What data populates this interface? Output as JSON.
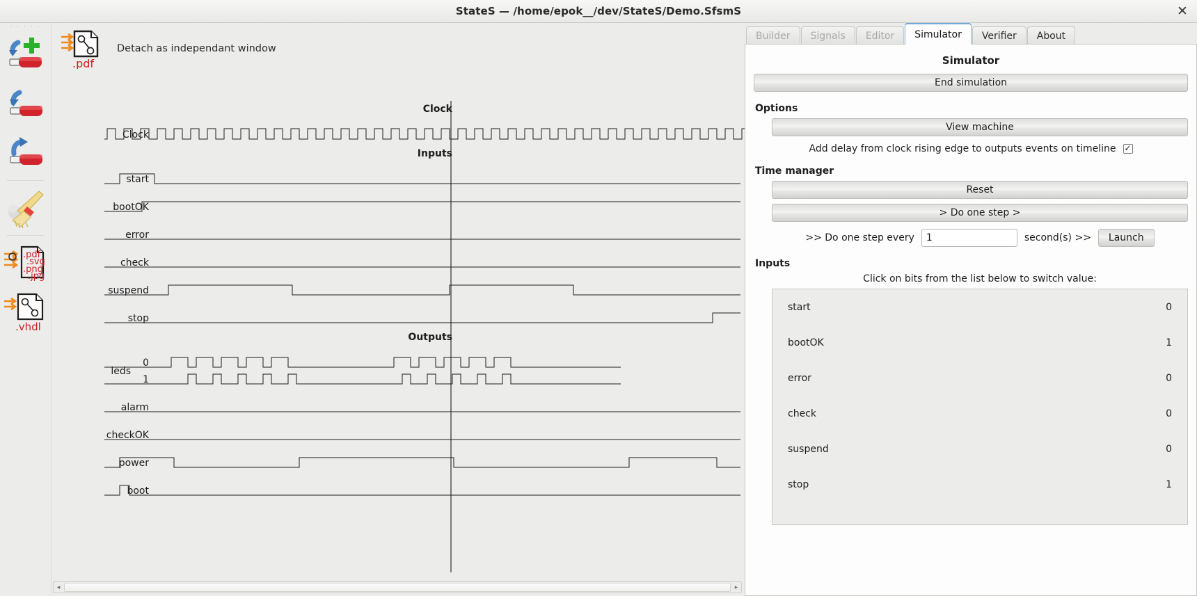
{
  "window": {
    "title": "StateS — /home/epok__/dev/StateS/Demo.SfsmS",
    "close_label": "✕"
  },
  "rail": {
    "handle": "· · · · ·",
    "items": [
      {
        "name": "save-as-new-icon",
        "tooltip": "Save as new"
      },
      {
        "name": "save-icon",
        "tooltip": "Save"
      },
      {
        "name": "load-icon",
        "tooltip": "Load"
      },
      {
        "name": "clear-icon",
        "tooltip": "Clear"
      },
      {
        "name": "export-image-icon",
        "labels": [
          ".pdf",
          ".svg",
          ".png",
          ".jpg"
        ]
      },
      {
        "name": "export-vhdl-icon",
        "labels": [
          ".vhdl"
        ]
      }
    ]
  },
  "wave_panel": {
    "detach_label": "Detach as independant window",
    "detach_icon_label": ".pdf",
    "scrollbar": {
      "left_arrow": "◂",
      "right_arrow": "▸"
    }
  },
  "tabs": [
    {
      "label": "Builder",
      "state": "disabled"
    },
    {
      "label": "Signals",
      "state": "disabled"
    },
    {
      "label": "Editor",
      "state": "disabled"
    },
    {
      "label": "Simulator",
      "state": "active"
    },
    {
      "label": "Verifier",
      "state": "enabled"
    },
    {
      "label": "About",
      "state": "enabled"
    }
  ],
  "simulator": {
    "title": "Simulator",
    "end_simulation_label": "End simulation",
    "options_head": "Options",
    "view_machine_label": "View machine",
    "delay_option_label": "Add delay from clock rising edge to outputs events on timeline",
    "delay_option_checked": true,
    "delay_option_tick": "✓",
    "time_manager_head": "Time manager",
    "reset_label": "Reset",
    "do_one_step_label": "> Do one step >",
    "do_every_prefix": ">> Do one step every",
    "do_every_value": "1",
    "do_every_suffix": "second(s) >>",
    "launch_label": "Launch",
    "inputs_head": "Inputs",
    "inputs_hint": "Click on bits from the list below to switch value:",
    "input_bits": [
      {
        "name": "start",
        "value": "0"
      },
      {
        "name": "bootOK",
        "value": "1"
      },
      {
        "name": "error",
        "value": "0"
      },
      {
        "name": "check",
        "value": "0"
      },
      {
        "name": "suspend",
        "value": "0"
      },
      {
        "name": "stop",
        "value": "1"
      }
    ]
  },
  "timeline": {
    "group_labels": {
      "clock": "Clock",
      "inputs": "Inputs",
      "outputs": "Outputs"
    },
    "signals": [
      {
        "label": "Clock",
        "group": "clock",
        "sub": null
      },
      {
        "label": "start",
        "group": "inputs",
        "sub": null
      },
      {
        "label": "bootOK",
        "group": "inputs",
        "sub": null
      },
      {
        "label": "error",
        "group": "inputs",
        "sub": null
      },
      {
        "label": "check",
        "group": "inputs",
        "sub": null
      },
      {
        "label": "suspend",
        "group": "inputs",
        "sub": null
      },
      {
        "label": "stop",
        "group": "inputs",
        "sub": null
      },
      {
        "label": "leds",
        "group": "outputs",
        "sub": "0"
      },
      {
        "label": "leds",
        "group": "outputs",
        "sub": "1"
      },
      {
        "label": "alarm",
        "group": "outputs",
        "sub": null
      },
      {
        "label": "checkOK",
        "group": "outputs",
        "sub": null
      },
      {
        "label": "power",
        "group": "outputs",
        "sub": null
      },
      {
        "label": "boot",
        "group": "outputs",
        "sub": null
      }
    ]
  }
}
